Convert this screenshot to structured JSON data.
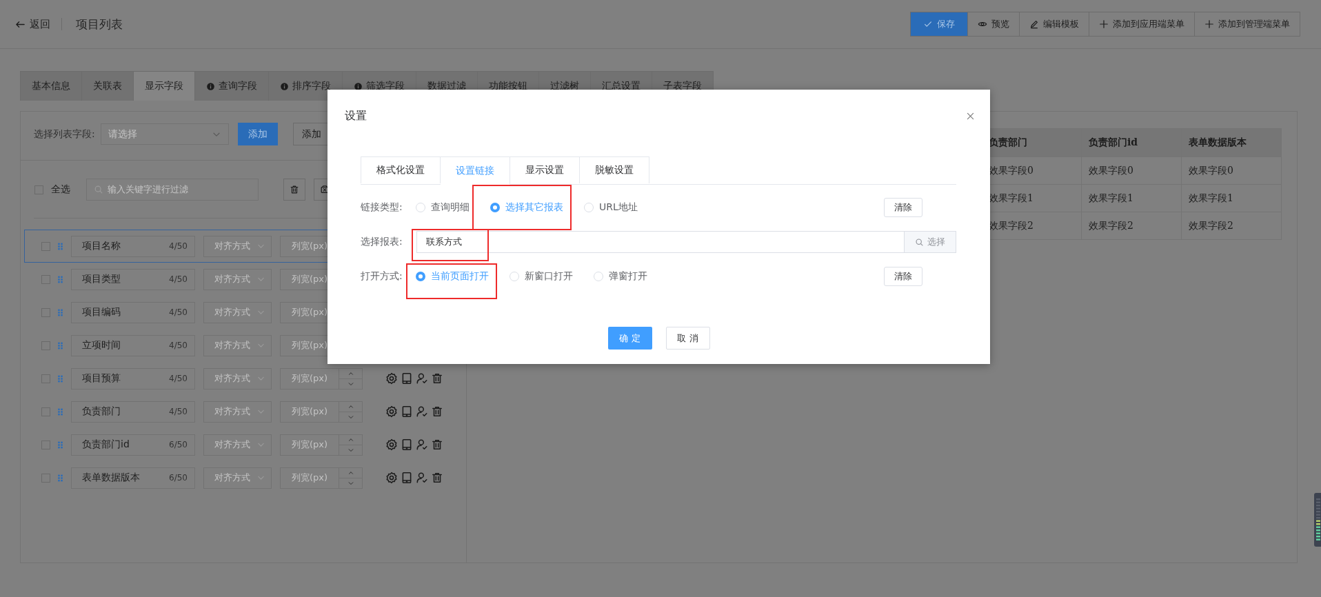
{
  "header": {
    "back": "返回",
    "title": "项目列表",
    "buttons": [
      {
        "label": "保存",
        "kind": "save"
      },
      {
        "label": "预览",
        "kind": "preview"
      },
      {
        "label": "编辑模板",
        "kind": "template"
      },
      {
        "label": "添加到应用端菜单",
        "kind": "add"
      },
      {
        "label": "添加到管理端菜单",
        "kind": "add"
      }
    ]
  },
  "tabs": [
    {
      "label": "基本信息",
      "selected": false,
      "info": false
    },
    {
      "label": "关联表",
      "selected": false,
      "info": false
    },
    {
      "label": "显示字段",
      "selected": true,
      "info": false
    },
    {
      "label": "查询字段",
      "selected": false,
      "info": true
    },
    {
      "label": "排序字段",
      "selected": false,
      "info": true
    },
    {
      "label": "筛选字段",
      "selected": false,
      "info": true
    },
    {
      "label": "数据过滤",
      "selected": false,
      "info": false
    },
    {
      "label": "功能按钮",
      "selected": false,
      "info": false
    },
    {
      "label": "过滤树",
      "selected": false,
      "info": false
    },
    {
      "label": "汇总设置",
      "selected": false,
      "info": false
    },
    {
      "label": "子表字段",
      "selected": false,
      "info": false
    }
  ],
  "field_picker": {
    "label": "选择列表字段:",
    "placeholder": "请选择",
    "add_button": "添加",
    "second_button": "添加"
  },
  "filter": {
    "select_all": "全选",
    "checked": false,
    "placeholder": "输入关键字进行过滤"
  },
  "fields": [
    {
      "name": "项目名称",
      "count": "4/50",
      "align": "对齐方式",
      "width": "列宽(px)",
      "checked": false,
      "selected": true
    },
    {
      "name": "项目类型",
      "count": "4/50",
      "align": "对齐方式",
      "width": "列宽(px)",
      "checked": false,
      "selected": false
    },
    {
      "name": "项目编码",
      "count": "4/50",
      "align": "对齐方式",
      "width": "列宽(px)",
      "checked": false,
      "selected": false
    },
    {
      "name": "立项时间",
      "count": "4/50",
      "align": "对齐方式",
      "width": "列宽(px)",
      "checked": false,
      "selected": false
    },
    {
      "name": "项目预算",
      "count": "4/50",
      "align": "对齐方式",
      "width": "列宽(px)",
      "checked": false,
      "selected": false
    },
    {
      "name": "负责部门",
      "count": "4/50",
      "align": "对齐方式",
      "width": "列宽(px)",
      "checked": false,
      "selected": false
    },
    {
      "name": "负责部门id",
      "count": "6/50",
      "align": "对齐方式",
      "width": "列宽(px)",
      "checked": false,
      "selected": false
    },
    {
      "name": "表单数据版本",
      "count": "6/50",
      "align": "对齐方式",
      "width": "列宽(px)",
      "checked": false,
      "selected": false
    }
  ],
  "preview_table": {
    "columns": [
      "负责部门",
      "负责部门id",
      "表单数据版本"
    ],
    "rows": [
      [
        "效果字段0",
        "效果字段0",
        "效果字段0"
      ],
      [
        "效果字段1",
        "效果字段1",
        "效果字段1"
      ],
      [
        "效果字段2",
        "效果字段2",
        "效果字段2"
      ]
    ]
  },
  "dialog": {
    "title": "设置",
    "tabs": [
      {
        "label": "格式化设置",
        "selected": false
      },
      {
        "label": "设置链接",
        "selected": true
      },
      {
        "label": "显示设置",
        "selected": false
      },
      {
        "label": "脱敏设置",
        "selected": false
      }
    ],
    "link_type": {
      "label": "链接类型:",
      "options": [
        {
          "label": "查询明细",
          "selected": false,
          "highlighted": false
        },
        {
          "label": "选择其它报表",
          "selected": true,
          "highlighted": true
        },
        {
          "label": "URL地址",
          "selected": false,
          "highlighted": false
        }
      ],
      "clear": "清除"
    },
    "report": {
      "label": "选择报表:",
      "value": "联系方式",
      "highlighted": true,
      "button": "选择"
    },
    "open_mode": {
      "label": "打开方式:",
      "options": [
        {
          "label": "当前页面打开",
          "selected": true,
          "highlighted": true
        },
        {
          "label": "新窗口打开",
          "selected": false,
          "highlighted": false
        },
        {
          "label": "弹窗打开",
          "selected": false,
          "highlighted": false
        }
      ],
      "clear": "清除"
    },
    "ok": "确 定",
    "cancel": "取 消"
  }
}
